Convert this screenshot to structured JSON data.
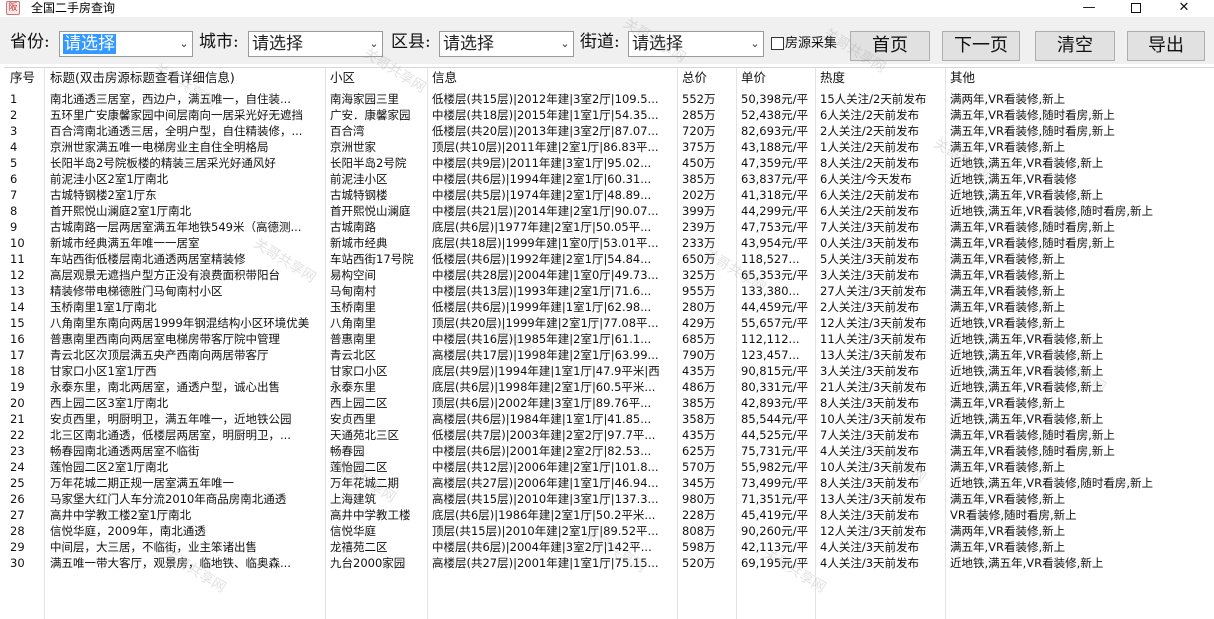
{
  "window": {
    "title": "全国二手房查询",
    "controls": {
      "minimize": "—",
      "close": "✕"
    }
  },
  "toolbar": {
    "province_label": "省份:",
    "province_value": "请选择",
    "city_label": "城市:",
    "city_value": "请选择",
    "county_label": "区县:",
    "county_value": "请选择",
    "street_label": "街道:",
    "street_value": "请选择",
    "collect_label": "房源采集",
    "collect_checked": false,
    "first_page": "首页",
    "next_page": "下一页",
    "clear": "清空",
    "export": "导出"
  },
  "table": {
    "columns": [
      "序号",
      "标题(双击房源标题查看详细信息)",
      "小区",
      "信息",
      "总价",
      "单价",
      "热度",
      "其他"
    ],
    "rows": [
      [
        "1",
        "南北通透三居室，西边户，满五唯一，自住装...",
        "南海家园三里",
        "低楼层(共15层)|2012年建|3室2厅|109.5...",
        "552万",
        "50,398元/平",
        "15人关注/2天前发布",
        "满两年,VR看装修,新上"
      ],
      [
        "2",
        "五环里广安康馨家园中间层南向一居采光好无遮挡",
        "广安．康馨家园",
        "中楼层(共18层)|2015年建|1室1厅|54.35...",
        "285万",
        "52,438元/平",
        "6人关注/2天前发布",
        "满五年,VR看装修,随时看房,新上"
      ],
      [
        "3",
        "百合湾南北通透三居，全明户型，自住精装修，...",
        "百合湾",
        "低楼层(共20层)|2013年建|3室2厅|87.07...",
        "720万",
        "82,693元/平",
        "2人关注/2天前发布",
        "满五年,VR看装修,随时看房,新上"
      ],
      [
        "4",
        "京洲世家满五唯一电梯房业主自住全明格局",
        "京洲世家",
        "顶层(共10层)|2011年建|2室1厅|86.83平...",
        "375万",
        "43,188元/平",
        "1人关注/2天前发布",
        "满五年,VR看装修,新上"
      ],
      [
        "5",
        "长阳半岛2号院板楼的精装三居采光好通风好",
        "长阳半岛2号院",
        "中楼层(共9层)|2011年建|3室1厅|95.02...",
        "450万",
        "47,359元/平",
        "8人关注/2天前发布",
        "近地铁,满五年,VR看装修,新上"
      ],
      [
        "6",
        "前泥洼小区2室1厅南北",
        "前泥洼小区",
        "中楼层(共6层)|1994年建|2室1厅|60.31...",
        "385万",
        "63,837元/平",
        "6人关注/今天发布",
        "近地铁,满五年,VR看装修"
      ],
      [
        "7",
        "古城特钢楼2室1厅东",
        "古城特钢楼",
        "中楼层(共5层)|1974年建|2室1厅|48.89...",
        "202万",
        "41,318元/平",
        "6人关注/2天前发布",
        "近地铁,满五年,VR看装修,新上"
      ],
      [
        "8",
        "首开熙悦山澜庭2室1厅南北",
        "首开熙悦山澜庭",
        "中楼层(共21层)|2014年建|2室1厅|90.07...",
        "399万",
        "44,299元/平",
        "6人关注/2天前发布",
        "近地铁,满五年,VR看装修,随时看房,新上"
      ],
      [
        "9",
        "古城南路一层两居室满五年地铁549米（高德测...",
        "古城南路",
        "底层(共6层)|1977年建|2室1厅|50.05平...",
        "239万",
        "47,753元/平",
        "7人关注/3天前发布",
        "满五年,VR看装修,随时看房,新上"
      ],
      [
        "10",
        "新城市经典满五年唯一一居室",
        "新城市经典",
        "底层(共18层)|1999年建|1室0厅|53.01平...",
        "233万",
        "43,954元/平",
        "0人关注/3天前发布",
        "满五年,VR看装修,随时看房,新上"
      ],
      [
        "11",
        "车站西街低楼层南北通透两居室精装修",
        "车站西街17号院",
        "低楼层(共6层)|1992年建|2室1厅|54.84...",
        "650万",
        "118,527...",
        "5人关注/3天前发布",
        "满五年,VR看装修,新上"
      ],
      [
        "12",
        "高层观景无遮挡户型方正没有浪费面积带阳台",
        "易构空间",
        "中楼层(共28层)|2004年建|1室0厅|49.73...",
        "325万",
        "65,353元/平",
        "3人关注/3天前发布",
        "满五年,VR看装修,新上"
      ],
      [
        "13",
        "精装修带电梯德胜门马甸南村小区",
        "马甸南村",
        "中楼层(共13层)|1993年建|2室1厅|71.6...",
        "955万",
        "133,380...",
        "27人关注/3天前发布",
        "满五年,VR看装修,新上"
      ],
      [
        "14",
        "玉桥南里1室1厅南北",
        "玉桥南里",
        "低楼层(共6层)|1999年建|1室1厅|62.98...",
        "280万",
        "44,459元/平",
        "2人关注/3天前发布",
        "满五年,VR看装修,新上"
      ],
      [
        "15",
        "八角南里东南向两居1999年钢混结构小区环境优美",
        "八角南里",
        "顶层(共20层)|1999年建|2室1厅|77.08平...",
        "429万",
        "55,657元/平",
        "12人关注/3天前发布",
        "近地铁,VR看装修,新上"
      ],
      [
        "16",
        "普惠南里西南向两居室电梯房带客厅院中管理",
        "普惠南里",
        "中楼层(共16层)|1985年建|2室1厅|61.1...",
        "685万",
        "112,112...",
        "11人关注/3天前发布",
        "近地铁,满五年,VR看装修,新上"
      ],
      [
        "17",
        "青云北区次顶层满五央产西南向两居带客厅",
        "青云北区",
        "高楼层(共17层)|1998年建|2室1厅|63.99...",
        "790万",
        "123,457...",
        "13人关注/3天前发布",
        "近地铁,满五年,VR看装修,新上"
      ],
      [
        "18",
        "甘家口小区1室1厅西",
        "甘家口小区",
        "底层(共9层)|1994年建|1室1厅|47.9平米|西",
        "435万",
        "90,815元/平",
        "3人关注/3天前发布",
        "近地铁,满五年,VR看装修,新上"
      ],
      [
        "19",
        "永泰东里，南北两居室，通透户型，诚心出售",
        "永泰东里",
        "底层(共6层)|1998年建|2室1厅|60.5平米...",
        "486万",
        "80,331元/平",
        "21人关注/3天前发布",
        "近地铁,满五年,VR看装修,新上"
      ],
      [
        "20",
        "西上园二区3室1厅南北",
        "西上园二区",
        "顶层(共6层)|2002年建|3室1厅|89.76平...",
        "385万",
        "42,893元/平",
        "8人关注/3天前发布",
        "满五年,VR看装修,新上"
      ],
      [
        "21",
        "安贞西里，明厨明卫，满五年唯一，近地铁公园",
        "安贞西里",
        "高楼层(共6层)|1984年建|1室1厅|41.85...",
        "358万",
        "85,544元/平",
        "10人关注/3天前发布",
        "近地铁,满五年,VR看装修,新上"
      ],
      [
        "22",
        "北三区南北通透，低楼层两居室，明厨明卫，...",
        "天通苑北三区",
        "低楼层(共7层)|2003年建|2室2厅|97.7平...",
        "435万",
        "44,525元/平",
        "7人关注/3天前发布",
        "满五年,VR看装修,随时看房,新上"
      ],
      [
        "23",
        "畅春园南北通透两居室不临街",
        "畅春园",
        "中楼层(共6层)|2001年建|2室2厅|82.53...",
        "625万",
        "75,731元/平",
        "4人关注/3天前发布",
        "满五年,VR看装修,随时看房,新上"
      ],
      [
        "24",
        "莲怡园二区2室1厅南北",
        "莲怡园二区",
        "中楼层(共12层)|2006年建|2室1厅|101.8...",
        "570万",
        "55,982元/平",
        "10人关注/3天前发布",
        "满五年,VR看装修,新上"
      ],
      [
        "25",
        "万年花城二期正规一居室满五年唯一",
        "万年花城二期",
        "高楼层(共27层)|2006年建|1室1厅|46.94...",
        "345万",
        "73,499元/平",
        "8人关注/3天前发布",
        "近地铁,满五年,VR看装修,随时看房,新上"
      ],
      [
        "26",
        "马家堡大红门人车分流2010年商品房南北通透",
        "上海建筑",
        "高楼层(共15层)|2010年建|3室1厅|137.3...",
        "980万",
        "71,351元/平",
        "13人关注/3天前发布",
        "满五年,VR看装修,新上"
      ],
      [
        "27",
        "高井中学教工楼2室1厅南北",
        "高井中学教工楼",
        "底层(共6层)|1986年建|2室1厅|50.2平米...",
        "228万",
        "45,419元/平",
        "8人关注/3天前发布",
        "VR看装修,随时看房,新上"
      ],
      [
        "28",
        "信悦华庭，2009年，南北通透",
        "信悦华庭",
        "顶层(共15层)|2010年建|2室1厅|89.52平...",
        "808万",
        "90,260元/平",
        "12人关注/3天前发布",
        "满两年,VR看装修,新上"
      ],
      [
        "29",
        "中间层，大三居，不临街，业主笨诸出售",
        "龙禧苑二区",
        "中楼层(共6层)|2004年建|3室2厅|142平...",
        "598万",
        "42,113元/平",
        "4人关注/3天前发布",
        "满五年,VR看装修,新上"
      ],
      [
        "30",
        "满五唯一带大客厅，观景房，临地铁、临奥森...",
        "九台2000家园",
        "高楼层(共27层)|2001年建|1室1厅|75.15...",
        "520万",
        "69,195元/平",
        "4人关注/3天前发布",
        "近地铁,满五年,VR看装修,新上"
      ]
    ]
  }
}
